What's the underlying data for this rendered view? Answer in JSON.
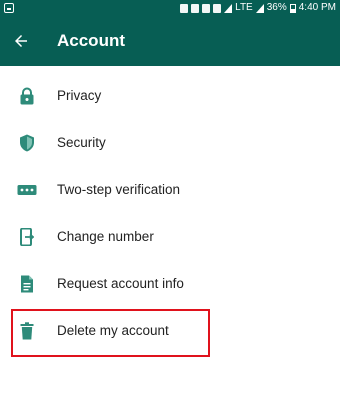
{
  "status_bar": {
    "battery": "36%",
    "time": "4:40 PM",
    "network": "LTE"
  },
  "app_bar": {
    "title": "Account",
    "back_icon": "arrow-left-icon",
    "color": "#075e54"
  },
  "menu": {
    "items": [
      {
        "label": "Privacy",
        "icon": "lock-icon"
      },
      {
        "label": "Security",
        "icon": "shield-icon"
      },
      {
        "label": "Two-step verification",
        "icon": "dots-keypad-icon"
      },
      {
        "label": "Change number",
        "icon": "phone-swap-icon"
      },
      {
        "label": "Request account info",
        "icon": "document-icon"
      },
      {
        "label": "Delete my account",
        "icon": "trash-icon"
      }
    ],
    "icon_color": "#2e8b7a"
  },
  "highlight": {
    "color": "#e0121c",
    "target": "Delete my account"
  }
}
